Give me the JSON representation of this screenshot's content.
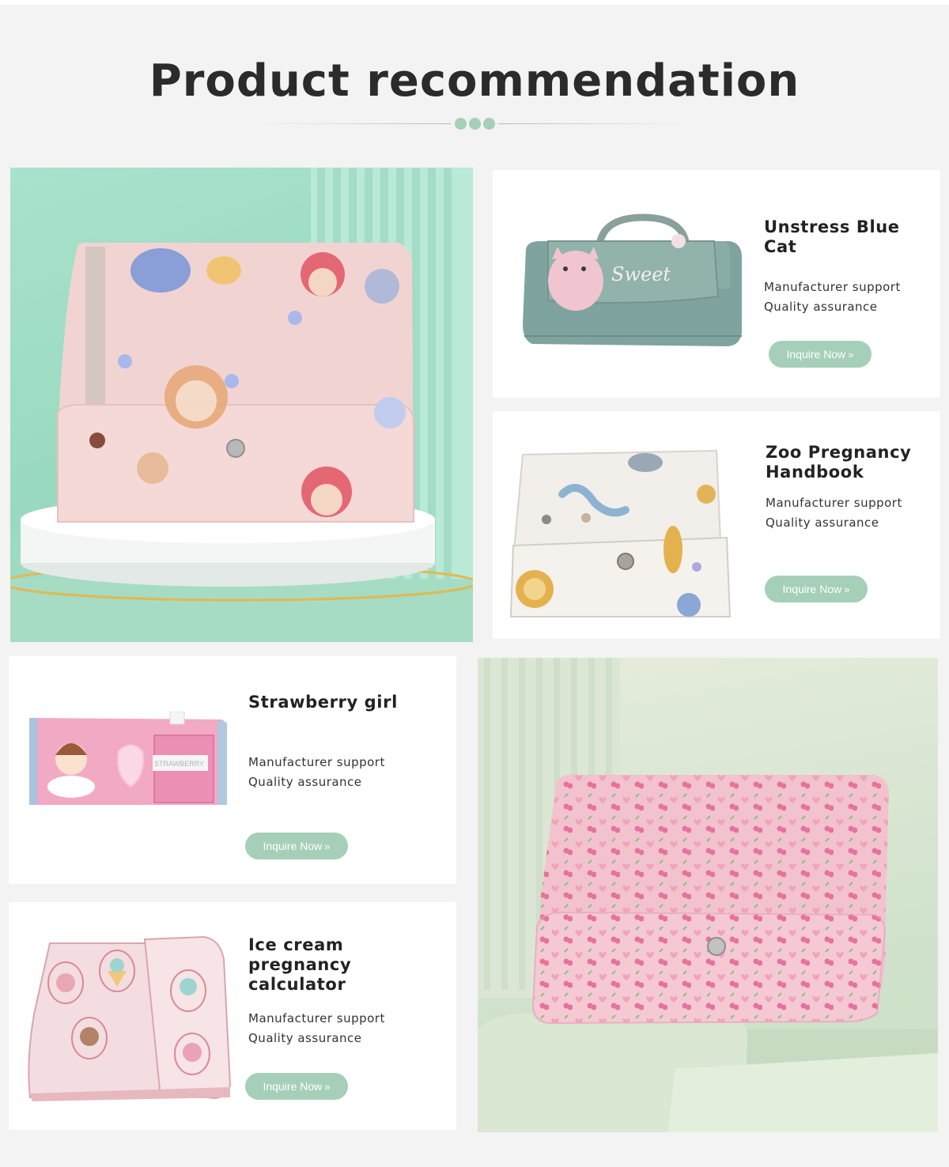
{
  "header": {
    "title": "Product recommendation"
  },
  "products": [
    {
      "name": "Unstress Blue Cat",
      "features": [
        "Manufacturer support",
        "Quality assurance"
      ],
      "button_label": "Inquire Now",
      "thumb_label": "Sweet"
    },
    {
      "name": "Zoo Pregnancy Handbook",
      "features": [
        "Manufacturer support",
        "Quality assurance"
      ],
      "button_label": "Inquire Now"
    },
    {
      "name": "Strawberry girl",
      "features": [
        "Manufacturer support",
        "Quality assurance"
      ],
      "button_label": "Inquire Now",
      "thumb_label": "STRAWBERRY"
    },
    {
      "name": "Ice cream pregnancy calculator",
      "features": [
        "Manufacturer support",
        "Quality assurance"
      ],
      "button_label": "Inquire Now"
    }
  ],
  "icons": {
    "button_icon": "double-chevron-right-icon",
    "divider_dots": 3
  },
  "colors": {
    "accent": "#a5cfb9",
    "background": "#f3f3f3",
    "card": "#ffffff",
    "title": "#2b2b2b"
  }
}
